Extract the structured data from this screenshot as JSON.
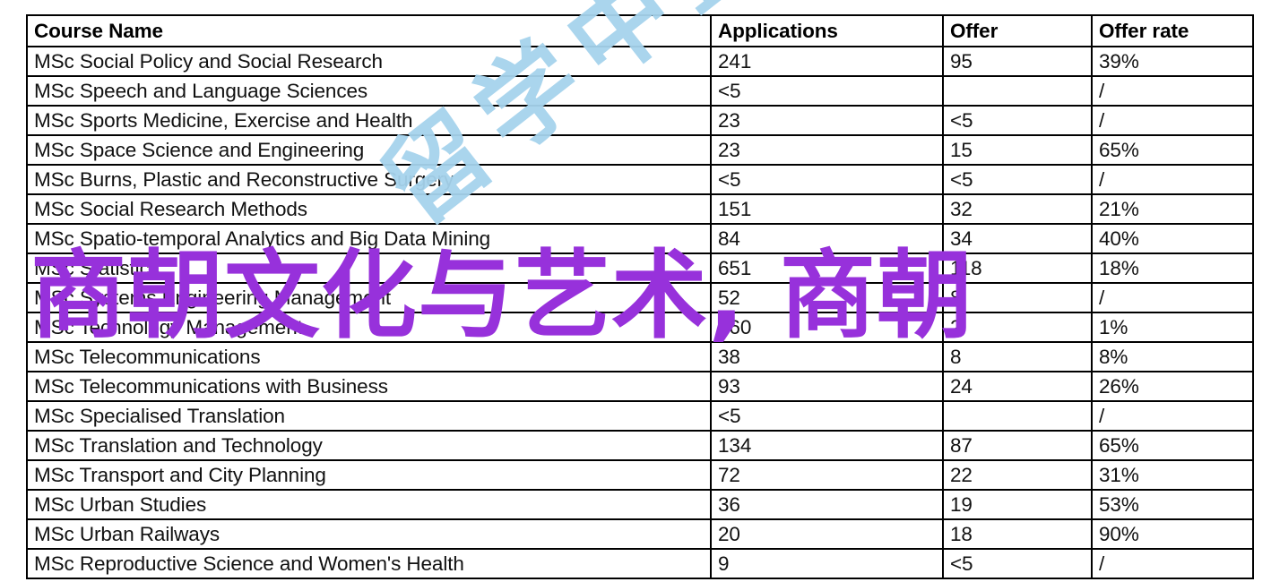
{
  "document": {
    "type": "statistics-table",
    "columns": [
      "Course Name",
      "Applications",
      "Offer",
      "Offer rate"
    ],
    "rows": [
      {
        "name": "MSc Social Policy and Social Research",
        "applications": "241",
        "offer": "95",
        "rate": "39%"
      },
      {
        "name": "MSc Speech and Language Sciences",
        "applications": "<5",
        "offer": "",
        "rate": "/"
      },
      {
        "name": "MSc Sports Medicine, Exercise and Health",
        "applications": "23",
        "offer": "<5",
        "rate": "/"
      },
      {
        "name": "MSc Space Science and Engineering",
        "applications": "23",
        "offer": "15",
        "rate": "65%"
      },
      {
        "name": "MSc Burns, Plastic and Reconstructive Surgery",
        "applications": "<5",
        "offer": "<5",
        "rate": "/"
      },
      {
        "name": "MSc Social Research Methods",
        "applications": "151",
        "offer": "32",
        "rate": "21%"
      },
      {
        "name": "MSc Spatio-temporal Analytics and Big Data Mining",
        "applications": "84",
        "offer": "34",
        "rate": "40%"
      },
      {
        "name": "MSc Statistics",
        "applications": "651",
        "offer": "118",
        "rate": "18%"
      },
      {
        "name": "MSc Systems Engineering Management",
        "applications": "52",
        "offer": "8",
        "rate": "/"
      },
      {
        "name": "MSc Technology Management",
        "applications": "160",
        "offer": "2",
        "rate": "1%"
      },
      {
        "name": "MSc Telecommunications",
        "applications": "38",
        "offer": "8",
        "rate": "8%"
      },
      {
        "name": "MSc Telecommunications with Business",
        "applications": "93",
        "offer": "24",
        "rate": "26%"
      },
      {
        "name": "MSc Specialised Translation",
        "applications": "<5",
        "offer": "",
        "rate": "/"
      },
      {
        "name": "MSc Translation and Technology",
        "applications": "134",
        "offer": "87",
        "rate": "65%"
      },
      {
        "name": "MSc Transport and City Planning",
        "applications": "72",
        "offer": "22",
        "rate": "31%"
      },
      {
        "name": "MSc Urban Studies",
        "applications": "36",
        "offer": "19",
        "rate": "53%"
      },
      {
        "name": "MSc Urban Railways",
        "applications": "20",
        "offer": "18",
        "rate": "90%"
      },
      {
        "name": "MSc Reproductive Science and Women's Health",
        "applications": "9",
        "offer": "<5",
        "rate": "/"
      }
    ]
  },
  "watermarks": {
    "purple": {
      "text": "商朝文化与艺术, 商朝",
      "color": "#9731DB"
    },
    "blue": {
      "text": "留学中蓝天地",
      "color": "#A6D3ED"
    }
  }
}
